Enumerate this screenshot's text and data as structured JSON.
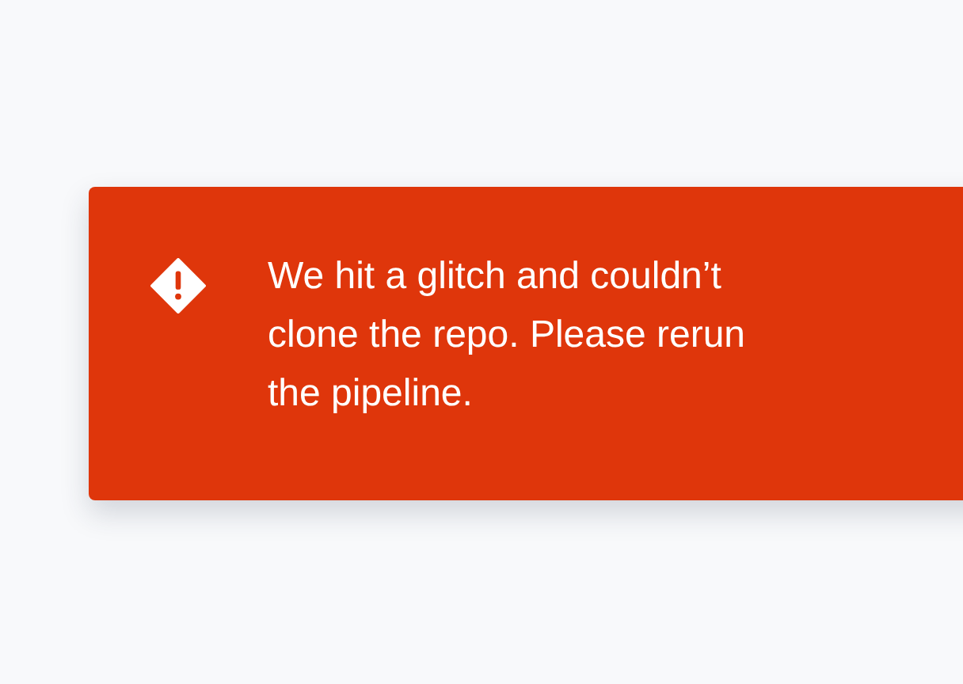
{
  "alert": {
    "kind": "error",
    "message": "We hit a glitch and couldn’t clone the repo. Please rerun the pipeline."
  }
}
